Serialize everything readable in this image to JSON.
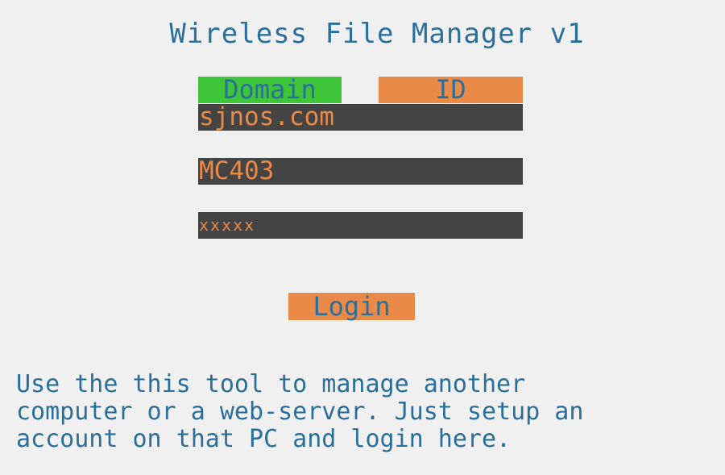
{
  "app": {
    "title": "Wireless File Manager v1"
  },
  "tabs": {
    "domain_label": "Domain",
    "id_label": "ID"
  },
  "form": {
    "domain_value": "sjnos.com",
    "id_value": "MC403",
    "password_value": "xxxxx"
  },
  "buttons": {
    "login_label": "Login"
  },
  "help": {
    "text": "Use the this tool to manage another\ncomputer or a web-server. Just setup an\naccount on that PC and login here."
  },
  "colors": {
    "background": "#f0f0f0",
    "text_blue": "#2a6f9a",
    "tab_green": "#3fc53a",
    "accent_orange": "#ea8a48",
    "field_dark": "#444444"
  }
}
